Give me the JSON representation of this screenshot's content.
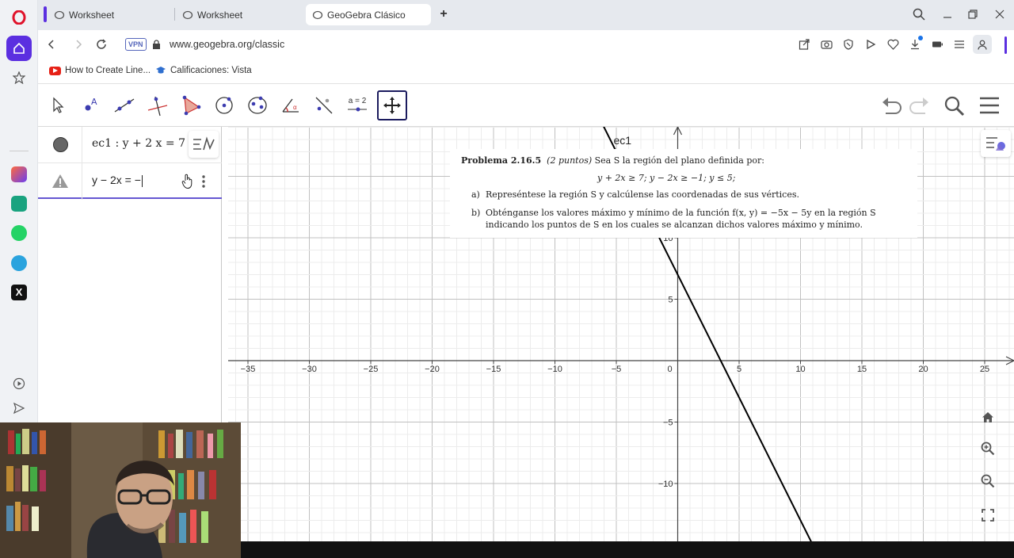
{
  "browser": {
    "tabs": [
      {
        "title": "Worksheet"
      },
      {
        "title": "Worksheet"
      },
      {
        "title": "GeoGebra Clásico"
      }
    ],
    "vpn_label": "VPN",
    "url": "www.geogebra.org/classic",
    "bookmarks": [
      {
        "label": "How to Create Line..."
      },
      {
        "label": "Calificaciones: Vista"
      }
    ]
  },
  "toolbar": {
    "tools": [
      "move-tool",
      "point-tool",
      "line-tool",
      "perpendicular-tool",
      "polygon-tool",
      "circle-tool",
      "conic-tool",
      "angle-tool",
      "reflect-tool",
      "slider-tool",
      "move-view-tool"
    ],
    "slider_label": "a = 2"
  },
  "algebra": {
    "rows": [
      {
        "expr": "ec1 : y + 2 x = 7",
        "status": "visible"
      },
      {
        "expr": "y − 2x = −",
        "status": "warning"
      }
    ]
  },
  "graphics": {
    "line_label": "ec1",
    "x_ticks": [
      "−35",
      "−30",
      "−25",
      "−20",
      "−15",
      "−10",
      "−5",
      "0",
      "5",
      "10",
      "15",
      "20",
      "25"
    ],
    "y_ticks": [
      "10",
      "5",
      "−5",
      "−10"
    ],
    "line": {
      "label": "ec1",
      "equation": "y + 2x = 7",
      "color": "#000000"
    }
  },
  "problem": {
    "title": "Problema 2.16.5",
    "points": "(2 puntos)",
    "intro": "Sea S la región del plano definida por:",
    "system": "y + 2x ≥ 7;   y − 2x ≥ −1;   y ≤ 5;",
    "a_label": "a)",
    "a_text": "Represéntese la región S y calcúlense las coordenadas de sus vértices.",
    "b_label": "b)",
    "b_text1": "Obténganse los valores máximo y mínimo de la función f(x, y) = −5x − 5y en la región S",
    "b_text2": "indicando los puntos de S en los cuales se alcanzan dichos valores máximo y mínimo."
  }
}
